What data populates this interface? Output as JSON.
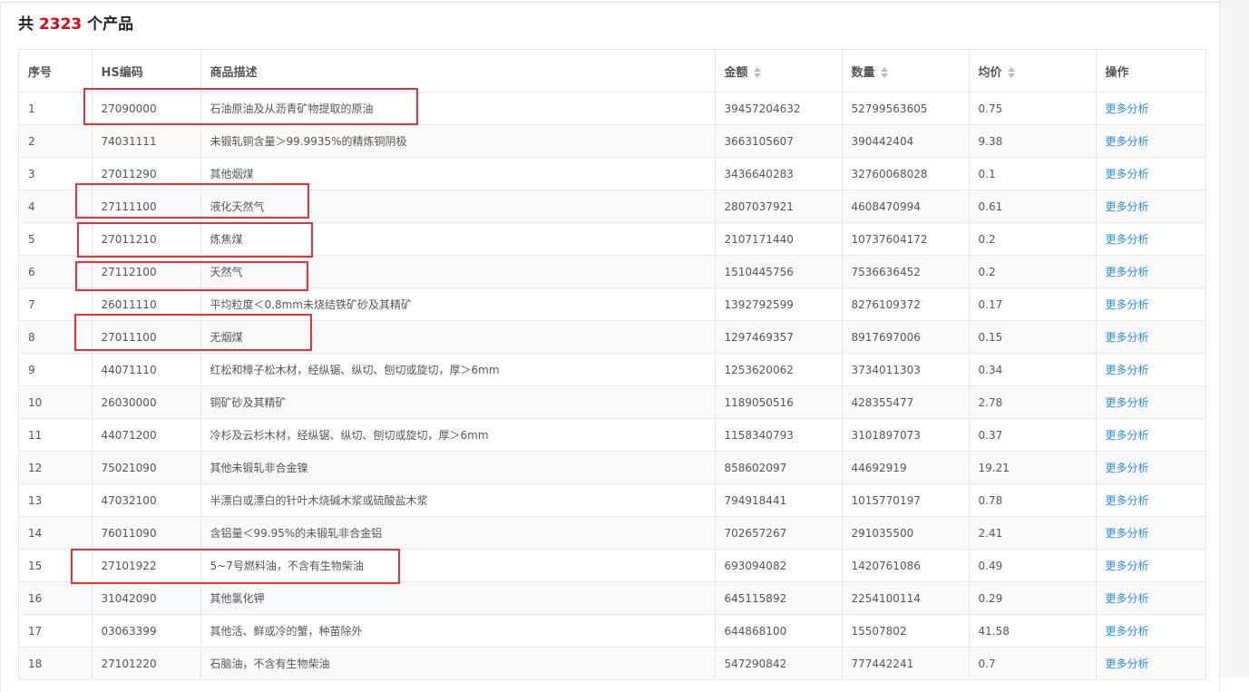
{
  "header": {
    "prefix": "共",
    "count": "2323",
    "suffix": "个产品"
  },
  "columns": {
    "no": "序号",
    "hs": "HS编码",
    "desc": "商品描述",
    "amount": "金额",
    "quantity": "数量",
    "avg": "均价",
    "op": "操作"
  },
  "rows": [
    {
      "no": "1",
      "hs": "27090000",
      "desc": "石油原油及从沥青矿物提取的原油",
      "amount": "39457204632",
      "qty": "52799563605",
      "avg": "0.75",
      "op": "更多分析"
    },
    {
      "no": "2",
      "hs": "74031111",
      "desc": "未锻轧铜含量＞99.9935%的精炼铜阴极",
      "amount": "3663105607",
      "qty": "390442404",
      "avg": "9.38",
      "op": "更多分析"
    },
    {
      "no": "3",
      "hs": "27011290",
      "desc": "其他烟煤",
      "amount": "3436640283",
      "qty": "32760068028",
      "avg": "0.1",
      "op": "更多分析"
    },
    {
      "no": "4",
      "hs": "27111100",
      "desc": "液化天然气",
      "amount": "2807037921",
      "qty": "4608470994",
      "avg": "0.61",
      "op": "更多分析"
    },
    {
      "no": "5",
      "hs": "27011210",
      "desc": "炼焦煤",
      "amount": "2107171440",
      "qty": "10737604172",
      "avg": "0.2",
      "op": "更多分析"
    },
    {
      "no": "6",
      "hs": "27112100",
      "desc": "天然气",
      "amount": "1510445756",
      "qty": "7536636452",
      "avg": "0.2",
      "op": "更多分析"
    },
    {
      "no": "7",
      "hs": "26011110",
      "desc": "平均粒度＜0.8mm未烧结铁矿砂及其精矿",
      "amount": "1392792599",
      "qty": "8276109372",
      "avg": "0.17",
      "op": "更多分析"
    },
    {
      "no": "8",
      "hs": "27011100",
      "desc": "无烟煤",
      "amount": "1297469357",
      "qty": "8917697006",
      "avg": "0.15",
      "op": "更多分析"
    },
    {
      "no": "9",
      "hs": "44071110",
      "desc": "红松和樟子松木材，经纵锯、纵切、刨切或旋切，厚＞6mm",
      "amount": "1253620062",
      "qty": "3734011303",
      "avg": "0.34",
      "op": "更多分析"
    },
    {
      "no": "10",
      "hs": "26030000",
      "desc": "铜矿砂及其精矿",
      "amount": "1189050516",
      "qty": "428355477",
      "avg": "2.78",
      "op": "更多分析"
    },
    {
      "no": "11",
      "hs": "44071200",
      "desc": "冷杉及云杉木材，经纵锯、纵切、刨切或旋切，厚＞6mm",
      "amount": "1158340793",
      "qty": "3101897073",
      "avg": "0.37",
      "op": "更多分析"
    },
    {
      "no": "12",
      "hs": "75021090",
      "desc": "其他未锻轧非合金镍",
      "amount": "858602097",
      "qty": "44692919",
      "avg": "19.21",
      "op": "更多分析"
    },
    {
      "no": "13",
      "hs": "47032100",
      "desc": "半漂白或漂白的针叶木烧碱木浆或硫酸盐木浆",
      "amount": "794918441",
      "qty": "1015770197",
      "avg": "0.78",
      "op": "更多分析"
    },
    {
      "no": "14",
      "hs": "76011090",
      "desc": "含铝量＜99.95%的未锻轧非合金铝",
      "amount": "702657267",
      "qty": "291035500",
      "avg": "2.41",
      "op": "更多分析"
    },
    {
      "no": "15",
      "hs": "27101922",
      "desc": "5~7号燃料油，不含有生物柴油",
      "amount": "693094082",
      "qty": "1420761086",
      "avg": "0.49",
      "op": "更多分析"
    },
    {
      "no": "16",
      "hs": "31042090",
      "desc": "其他氯化钾",
      "amount": "645115892",
      "qty": "2254100114",
      "avg": "0.29",
      "op": "更多分析"
    },
    {
      "no": "17",
      "hs": "03063399",
      "desc": "其他活、鲜或冷的蟹，种苗除外",
      "amount": "644868100",
      "qty": "15507802",
      "avg": "41.58",
      "op": "更多分析"
    },
    {
      "no": "18",
      "hs": "27101220",
      "desc": "石脑油，不含有生物柴油",
      "amount": "547290842",
      "qty": "777442241",
      "avg": "0.7",
      "op": "更多分析"
    }
  ],
  "highlighted_rows": [
    "1",
    "4",
    "5",
    "6",
    "8",
    "15"
  ],
  "colors": {
    "count": "#e60012",
    "link": "#2a8ce8",
    "highlight": "#e8303a"
  }
}
